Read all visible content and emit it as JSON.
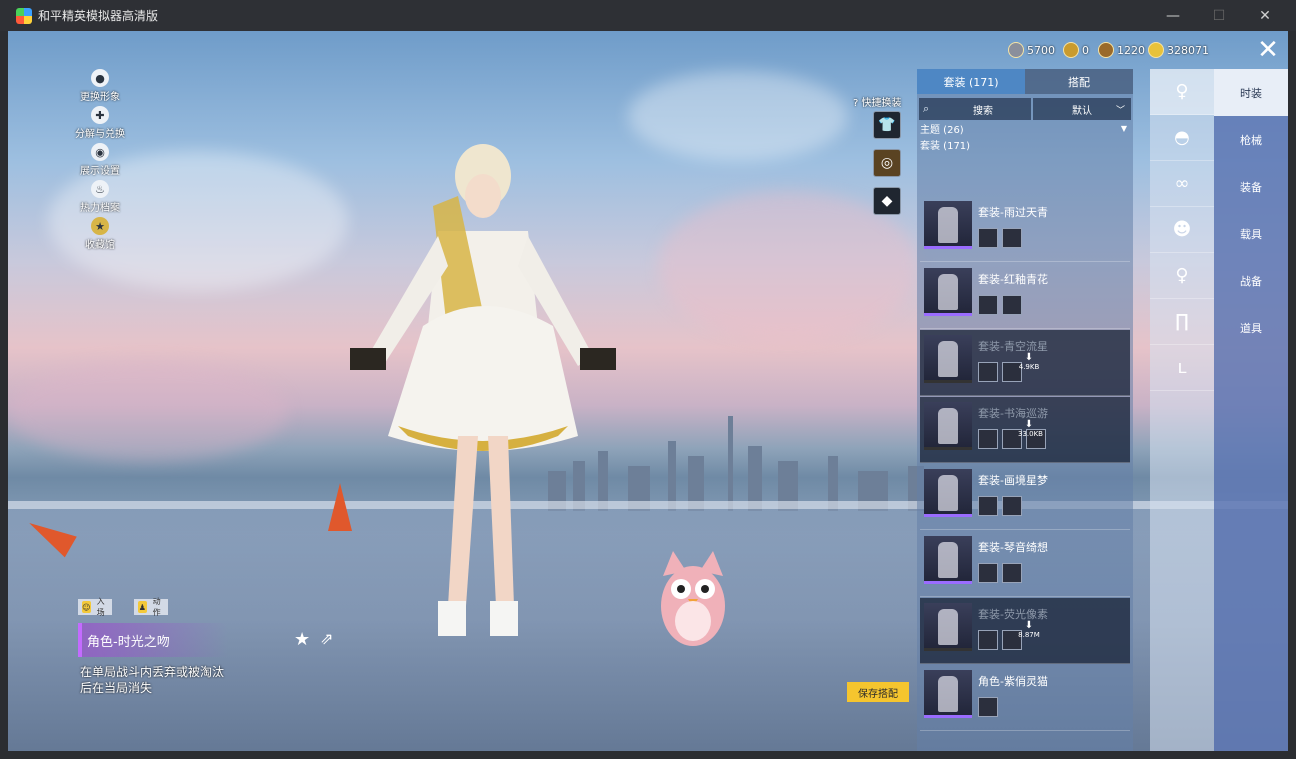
{
  "window": {
    "title": "和平精英模拟器高清版",
    "controls": [
      "—",
      "☐",
      "✕"
    ]
  },
  "currencies": [
    {
      "icon": "silver-coin-icon",
      "value": "5700"
    },
    {
      "icon": "gold-coin-icon",
      "value": "0"
    },
    {
      "icon": "bronze-medal-icon",
      "value": "1220"
    },
    {
      "icon": "ticket-coin-icon",
      "value": "328071"
    }
  ],
  "left_menu": [
    {
      "icon": "avatar-icon",
      "label": "更换形象"
    },
    {
      "icon": "puzzle-icon",
      "label": "分解与兑换"
    },
    {
      "icon": "eye-icon",
      "label": "展示设置"
    },
    {
      "icon": "flame-icon",
      "label": "热力档案"
    },
    {
      "icon": "badge-icon",
      "label": "收藏馆"
    }
  ],
  "quick_swap": {
    "label": "快捷换装"
  },
  "panel": {
    "tabs": [
      "套装 (171)",
      "搭配"
    ],
    "search_placeholder": "搜索",
    "sort_value": "默认",
    "theme_header": "主题 (26)",
    "suit_header": "套装 (171)",
    "items": [
      {
        "name": "套装-雨过天青",
        "state": "owned"
      },
      {
        "name": "套装-红釉青花",
        "state": "owned"
      },
      {
        "name": "套装-青空流星",
        "state": "download",
        "size": "4.9KB"
      },
      {
        "name": "套装-书海巡游",
        "state": "download",
        "size": "33.0KB"
      },
      {
        "name": "套装-画境星梦",
        "state": "owned"
      },
      {
        "name": "套装-琴音绮想",
        "state": "owned"
      },
      {
        "name": "套装-荧光像素",
        "state": "download",
        "size": "8.87M"
      },
      {
        "name": "角色-紫俏灵猫",
        "state": "owned"
      }
    ]
  },
  "category_icons": [
    "outfit-icon",
    "hat-icon",
    "goggles-icon",
    "mask-icon",
    "top-icon",
    "pants-icon",
    "shoes-icon"
  ],
  "right_tabs": [
    "时装",
    "枪械",
    "装备",
    "载具",
    "战备",
    "道具"
  ],
  "selected_item": {
    "action_buttons": [
      "入场",
      "动作"
    ],
    "name": "角色-时光之吻",
    "description": "在单局战斗内丢弃或被淘汰后在当局消失"
  },
  "save_button": "保存搭配"
}
